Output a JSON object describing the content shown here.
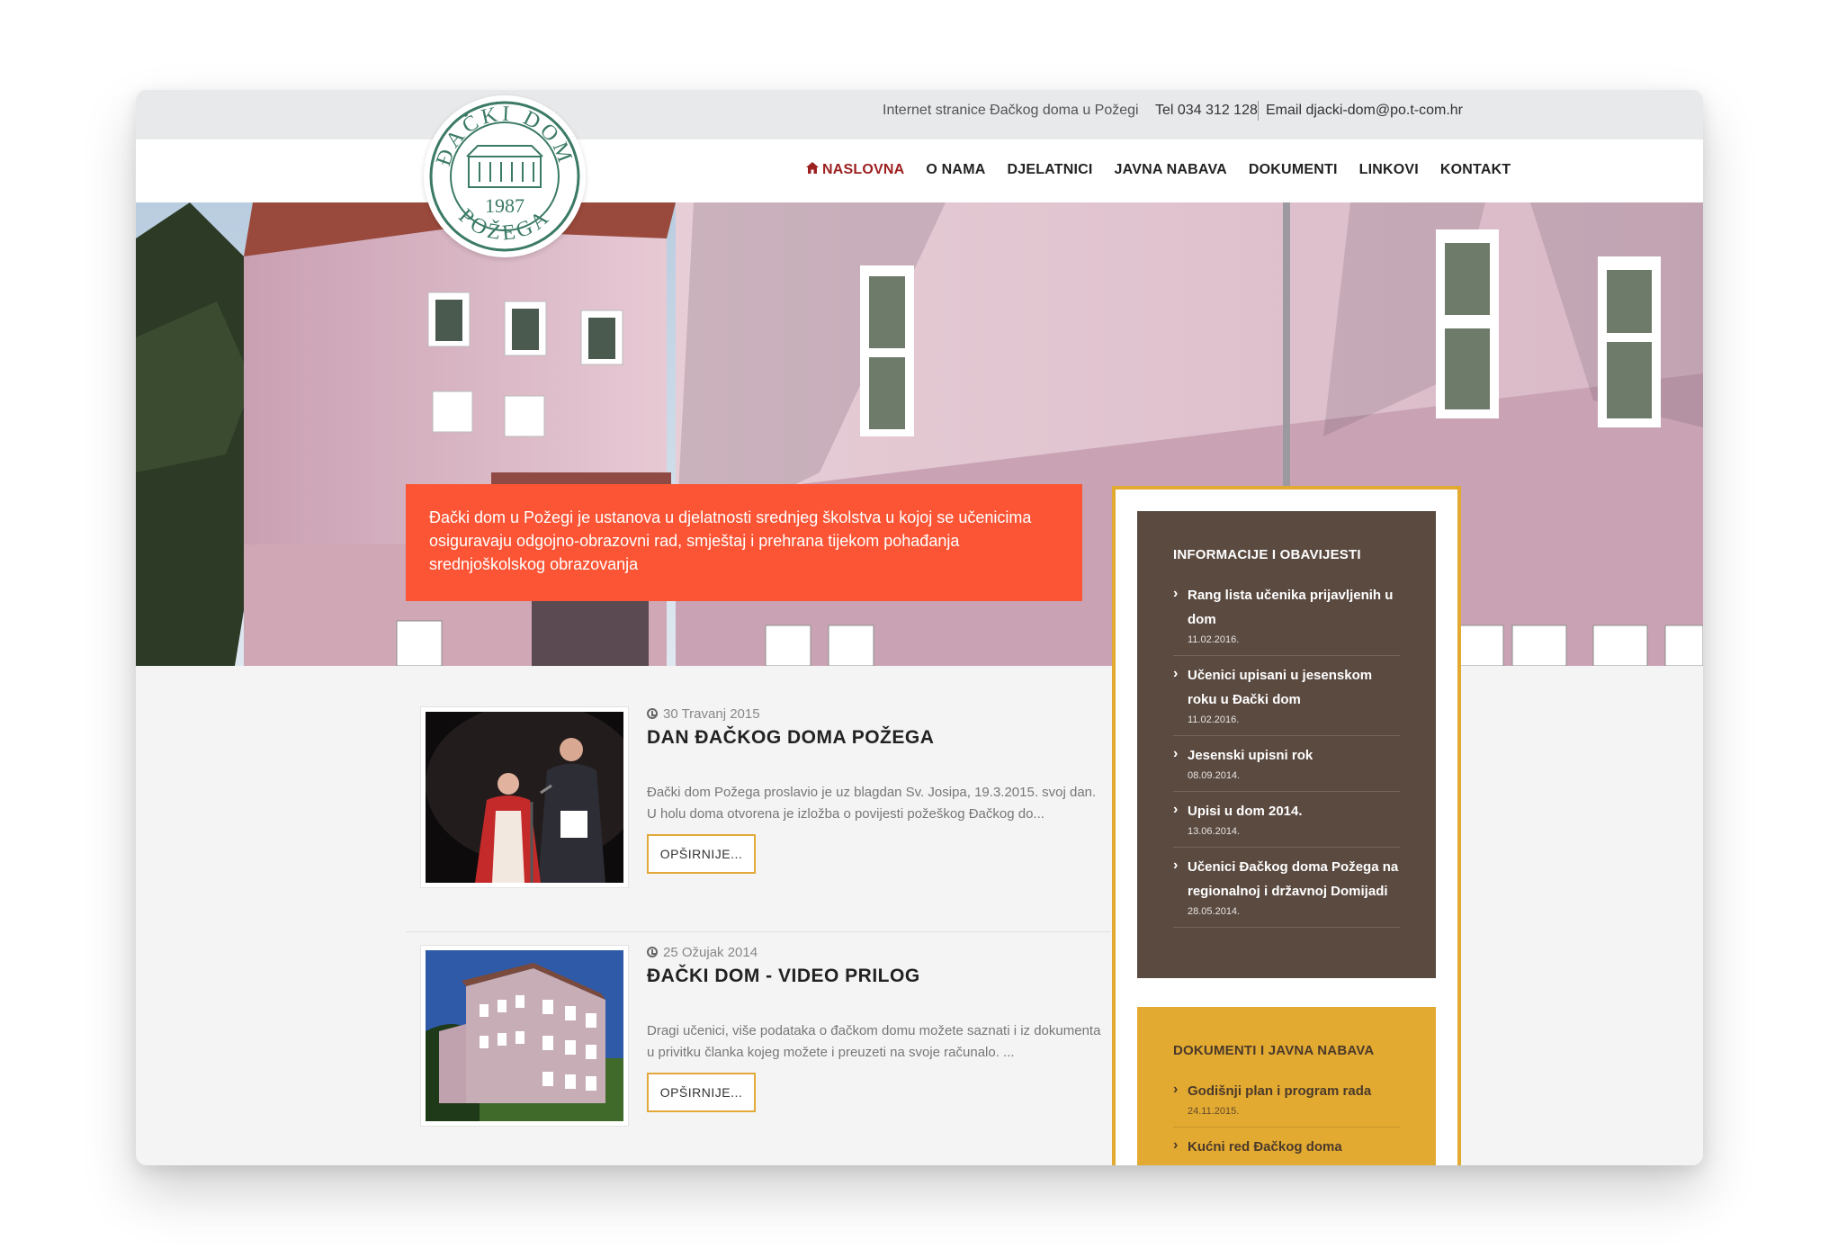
{
  "topbar": {
    "tagline": "Internet stranice Đačkog doma u Požegi",
    "tel": "Tel 034 312 128",
    "email_label": "Email",
    "email": "djacki-dom@po.t-com.hr"
  },
  "logo": {
    "top_text": "ĐAČKI DOM",
    "bottom_text": "POŽEGA",
    "year": "1987"
  },
  "nav": {
    "items": [
      {
        "label": "NASLOVNA",
        "active": true
      },
      {
        "label": "O NAMA"
      },
      {
        "label": "DJELATNICI"
      },
      {
        "label": "JAVNA NABAVA"
      },
      {
        "label": "DOKUMENTI"
      },
      {
        "label": "LINKOVI"
      },
      {
        "label": "KONTAKT"
      }
    ]
  },
  "hero": {
    "text": "Đački dom u Požegi je ustanova u djelatnosti srednjeg školstva u kojoj se učenicima osiguravaju odgojno-obrazovni rad, smještaj i prehrana tijekom pohađanja srednjoškolskog obrazovanja"
  },
  "articles": [
    {
      "date": "30 Travanj 2015",
      "title": "DAN ĐAČKOG DOMA POŽEGA",
      "excerpt": "Đački dom Požega proslavio je uz blagdan Sv. Josipa, 19.3.2015. svoj dan. U holu doma otvorena je izložba o povijesti požeškog Đačkog do...",
      "more": "OPŠIRNIJE..."
    },
    {
      "date": "25 Ožujak 2014",
      "title": "ĐAČKI DOM - VIDEO PRILOG",
      "excerpt": "Dragi učenici, više podataka o đačkom domu možete saznati i iz dokumenta u privitku članka kojeg možete i preuzeti na svoje računalo. ...",
      "more": "OPŠIRNIJE..."
    }
  ],
  "sidebar": {
    "info": {
      "title": "INFORMACIJE I OBAVIJESTI",
      "items": [
        {
          "title": "Rang lista učenika prijavljenih u dom",
          "date": "11.02.2016."
        },
        {
          "title": "Učenici upisani u jesenskom roku u Đački dom",
          "date": "11.02.2016."
        },
        {
          "title": "Jesenski upisni rok",
          "date": "08.09.2014."
        },
        {
          "title": "Upisi u dom 2014.",
          "date": "13.06.2014."
        },
        {
          "title": "Učenici Đačkog doma Požega na regionalnoj i državnoj Domijadi",
          "date": "28.05.2014."
        }
      ]
    },
    "docs": {
      "title": "DOKUMENTI I JAVNA NABAVA",
      "items": [
        {
          "title": "Godišnji plan i program rada",
          "date": "24.11.2015."
        },
        {
          "title": "Kućni red Đačkog doma",
          "date": ""
        }
      ]
    }
  },
  "colors": {
    "accent_orange": "#fb5535",
    "border_gold": "#e3aa32",
    "widget_brown": "#5b4a40",
    "nav_active": "#9c1f1f"
  },
  "icons": [
    "home-icon",
    "clock-icon",
    "chevron-right-icon"
  ]
}
